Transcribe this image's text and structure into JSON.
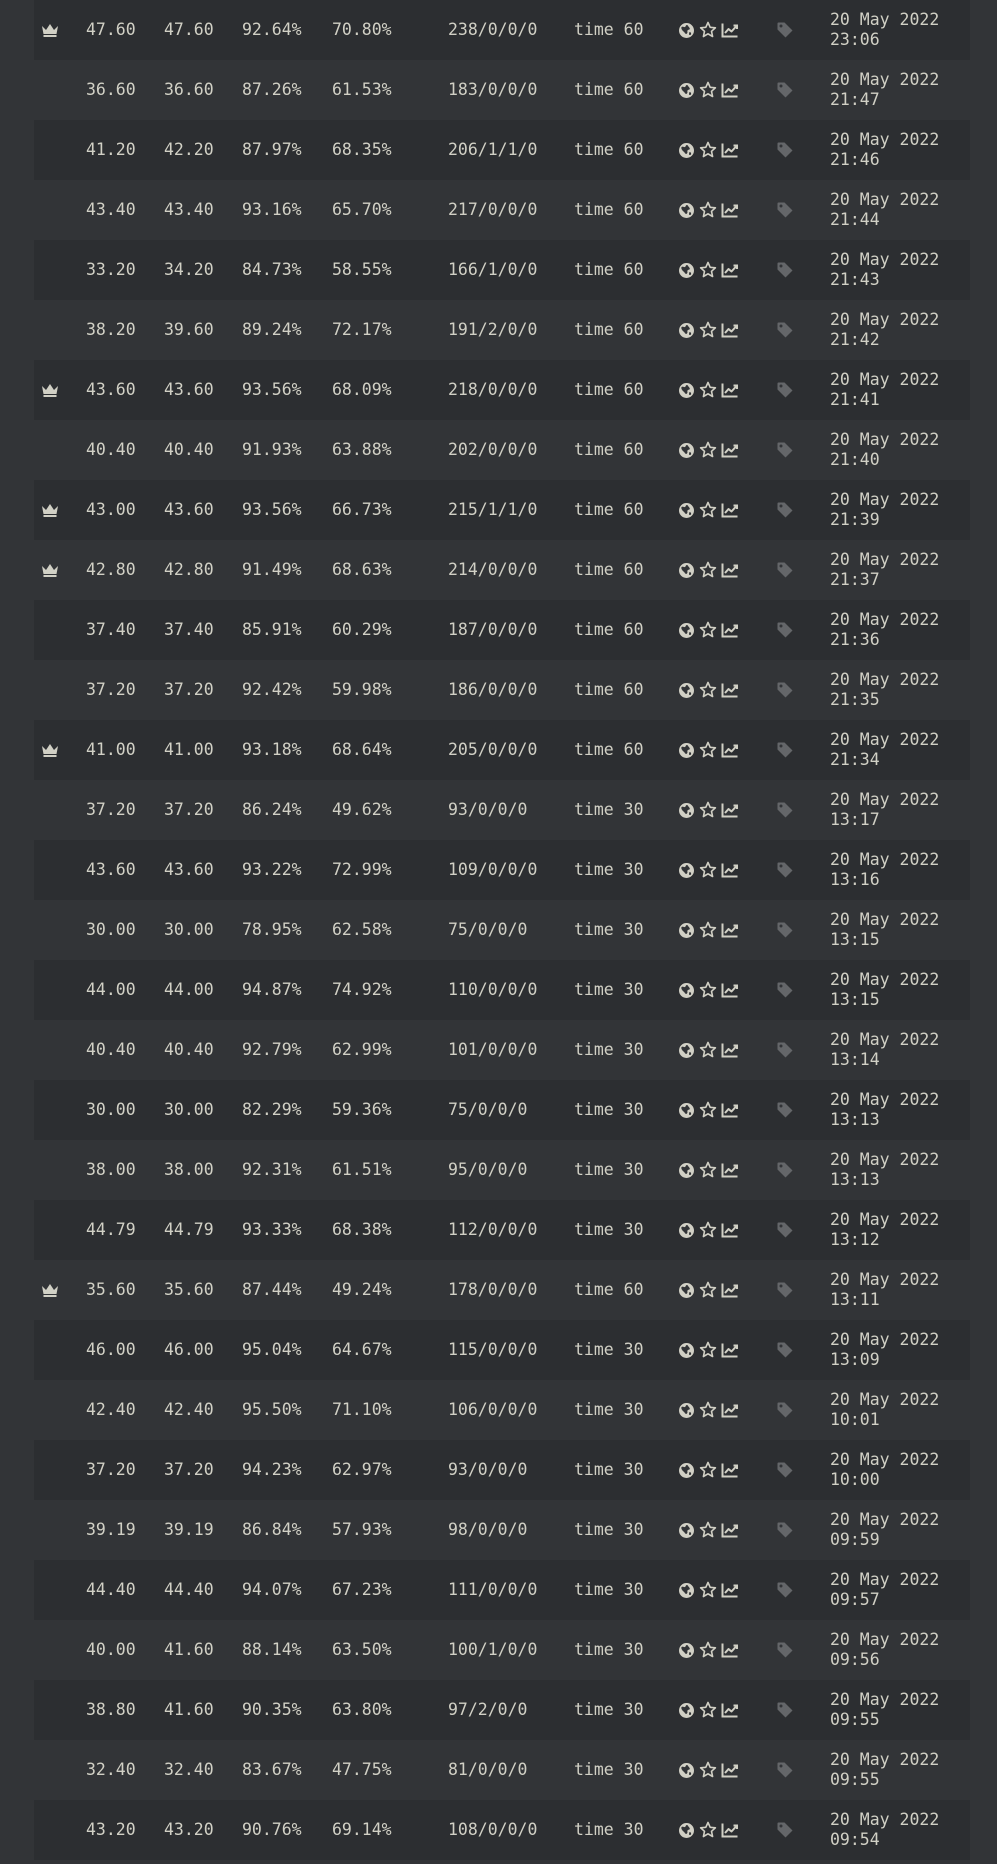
{
  "colors": {
    "background": "#323437",
    "row_alt": "#2c2e31",
    "text": "#d1d0c5",
    "tag_icon": "#646669"
  },
  "icons": {
    "crown": "crown-icon",
    "globe": "globe-icon",
    "star": "star-icon",
    "chart": "chart-line-icon",
    "tag": "tag-icon"
  },
  "rows": [
    {
      "pb": true,
      "wpm": "47.60",
      "raw": "47.60",
      "acc": "92.64%",
      "cons": "70.80%",
      "chars": "238/0/0/0",
      "mode": "time 60",
      "date": "20 May 2022",
      "time": "23:06"
    },
    {
      "pb": false,
      "wpm": "36.60",
      "raw": "36.60",
      "acc": "87.26%",
      "cons": "61.53%",
      "chars": "183/0/0/0",
      "mode": "time 60",
      "date": "20 May 2022",
      "time": "21:47"
    },
    {
      "pb": false,
      "wpm": "41.20",
      "raw": "42.20",
      "acc": "87.97%",
      "cons": "68.35%",
      "chars": "206/1/1/0",
      "mode": "time 60",
      "date": "20 May 2022",
      "time": "21:46"
    },
    {
      "pb": false,
      "wpm": "43.40",
      "raw": "43.40",
      "acc": "93.16%",
      "cons": "65.70%",
      "chars": "217/0/0/0",
      "mode": "time 60",
      "date": "20 May 2022",
      "time": "21:44"
    },
    {
      "pb": false,
      "wpm": "33.20",
      "raw": "34.20",
      "acc": "84.73%",
      "cons": "58.55%",
      "chars": "166/1/0/0",
      "mode": "time 60",
      "date": "20 May 2022",
      "time": "21:43"
    },
    {
      "pb": false,
      "wpm": "38.20",
      "raw": "39.60",
      "acc": "89.24%",
      "cons": "72.17%",
      "chars": "191/2/0/0",
      "mode": "time 60",
      "date": "20 May 2022",
      "time": "21:42"
    },
    {
      "pb": true,
      "wpm": "43.60",
      "raw": "43.60",
      "acc": "93.56%",
      "cons": "68.09%",
      "chars": "218/0/0/0",
      "mode": "time 60",
      "date": "20 May 2022",
      "time": "21:41"
    },
    {
      "pb": false,
      "wpm": "40.40",
      "raw": "40.40",
      "acc": "91.93%",
      "cons": "63.88%",
      "chars": "202/0/0/0",
      "mode": "time 60",
      "date": "20 May 2022",
      "time": "21:40"
    },
    {
      "pb": true,
      "wpm": "43.00",
      "raw": "43.60",
      "acc": "93.56%",
      "cons": "66.73%",
      "chars": "215/1/1/0",
      "mode": "time 60",
      "date": "20 May 2022",
      "time": "21:39"
    },
    {
      "pb": true,
      "wpm": "42.80",
      "raw": "42.80",
      "acc": "91.49%",
      "cons": "68.63%",
      "chars": "214/0/0/0",
      "mode": "time 60",
      "date": "20 May 2022",
      "time": "21:37"
    },
    {
      "pb": false,
      "wpm": "37.40",
      "raw": "37.40",
      "acc": "85.91%",
      "cons": "60.29%",
      "chars": "187/0/0/0",
      "mode": "time 60",
      "date": "20 May 2022",
      "time": "21:36"
    },
    {
      "pb": false,
      "wpm": "37.20",
      "raw": "37.20",
      "acc": "92.42%",
      "cons": "59.98%",
      "chars": "186/0/0/0",
      "mode": "time 60",
      "date": "20 May 2022",
      "time": "21:35"
    },
    {
      "pb": true,
      "wpm": "41.00",
      "raw": "41.00",
      "acc": "93.18%",
      "cons": "68.64%",
      "chars": "205/0/0/0",
      "mode": "time 60",
      "date": "20 May 2022",
      "time": "21:34"
    },
    {
      "pb": false,
      "wpm": "37.20",
      "raw": "37.20",
      "acc": "86.24%",
      "cons": "49.62%",
      "chars": "93/0/0/0",
      "mode": "time 30",
      "date": "20 May 2022",
      "time": "13:17"
    },
    {
      "pb": false,
      "wpm": "43.60",
      "raw": "43.60",
      "acc": "93.22%",
      "cons": "72.99%",
      "chars": "109/0/0/0",
      "mode": "time 30",
      "date": "20 May 2022",
      "time": "13:16"
    },
    {
      "pb": false,
      "wpm": "30.00",
      "raw": "30.00",
      "acc": "78.95%",
      "cons": "62.58%",
      "chars": "75/0/0/0",
      "mode": "time 30",
      "date": "20 May 2022",
      "time": "13:15"
    },
    {
      "pb": false,
      "wpm": "44.00",
      "raw": "44.00",
      "acc": "94.87%",
      "cons": "74.92%",
      "chars": "110/0/0/0",
      "mode": "time 30",
      "date": "20 May 2022",
      "time": "13:15"
    },
    {
      "pb": false,
      "wpm": "40.40",
      "raw": "40.40",
      "acc": "92.79%",
      "cons": "62.99%",
      "chars": "101/0/0/0",
      "mode": "time 30",
      "date": "20 May 2022",
      "time": "13:14"
    },
    {
      "pb": false,
      "wpm": "30.00",
      "raw": "30.00",
      "acc": "82.29%",
      "cons": "59.36%",
      "chars": "75/0/0/0",
      "mode": "time 30",
      "date": "20 May 2022",
      "time": "13:13"
    },
    {
      "pb": false,
      "wpm": "38.00",
      "raw": "38.00",
      "acc": "92.31%",
      "cons": "61.51%",
      "chars": "95/0/0/0",
      "mode": "time 30",
      "date": "20 May 2022",
      "time": "13:13"
    },
    {
      "pb": false,
      "wpm": "44.79",
      "raw": "44.79",
      "acc": "93.33%",
      "cons": "68.38%",
      "chars": "112/0/0/0",
      "mode": "time 30",
      "date": "20 May 2022",
      "time": "13:12"
    },
    {
      "pb": true,
      "wpm": "35.60",
      "raw": "35.60",
      "acc": "87.44%",
      "cons": "49.24%",
      "chars": "178/0/0/0",
      "mode": "time 60",
      "date": "20 May 2022",
      "time": "13:11"
    },
    {
      "pb": false,
      "wpm": "46.00",
      "raw": "46.00",
      "acc": "95.04%",
      "cons": "64.67%",
      "chars": "115/0/0/0",
      "mode": "time 30",
      "date": "20 May 2022",
      "time": "13:09"
    },
    {
      "pb": false,
      "wpm": "42.40",
      "raw": "42.40",
      "acc": "95.50%",
      "cons": "71.10%",
      "chars": "106/0/0/0",
      "mode": "time 30",
      "date": "20 May 2022",
      "time": "10:01"
    },
    {
      "pb": false,
      "wpm": "37.20",
      "raw": "37.20",
      "acc": "94.23%",
      "cons": "62.97%",
      "chars": "93/0/0/0",
      "mode": "time 30",
      "date": "20 May 2022",
      "time": "10:00"
    },
    {
      "pb": false,
      "wpm": "39.19",
      "raw": "39.19",
      "acc": "86.84%",
      "cons": "57.93%",
      "chars": "98/0/0/0",
      "mode": "time 30",
      "date": "20 May 2022",
      "time": "09:59"
    },
    {
      "pb": false,
      "wpm": "44.40",
      "raw": "44.40",
      "acc": "94.07%",
      "cons": "67.23%",
      "chars": "111/0/0/0",
      "mode": "time 30",
      "date": "20 May 2022",
      "time": "09:57"
    },
    {
      "pb": false,
      "wpm": "40.00",
      "raw": "41.60",
      "acc": "88.14%",
      "cons": "63.50%",
      "chars": "100/1/0/0",
      "mode": "time 30",
      "date": "20 May 2022",
      "time": "09:56"
    },
    {
      "pb": false,
      "wpm": "38.80",
      "raw": "41.60",
      "acc": "90.35%",
      "cons": "63.80%",
      "chars": "97/2/0/0",
      "mode": "time 30",
      "date": "20 May 2022",
      "time": "09:55"
    },
    {
      "pb": false,
      "wpm": "32.40",
      "raw": "32.40",
      "acc": "83.67%",
      "cons": "47.75%",
      "chars": "81/0/0/0",
      "mode": "time 30",
      "date": "20 May 2022",
      "time": "09:55"
    },
    {
      "pb": false,
      "wpm": "43.20",
      "raw": "43.20",
      "acc": "90.76%",
      "cons": "69.14%",
      "chars": "108/0/0/0",
      "mode": "time 30",
      "date": "20 May 2022",
      "time": "09:54"
    }
  ]
}
